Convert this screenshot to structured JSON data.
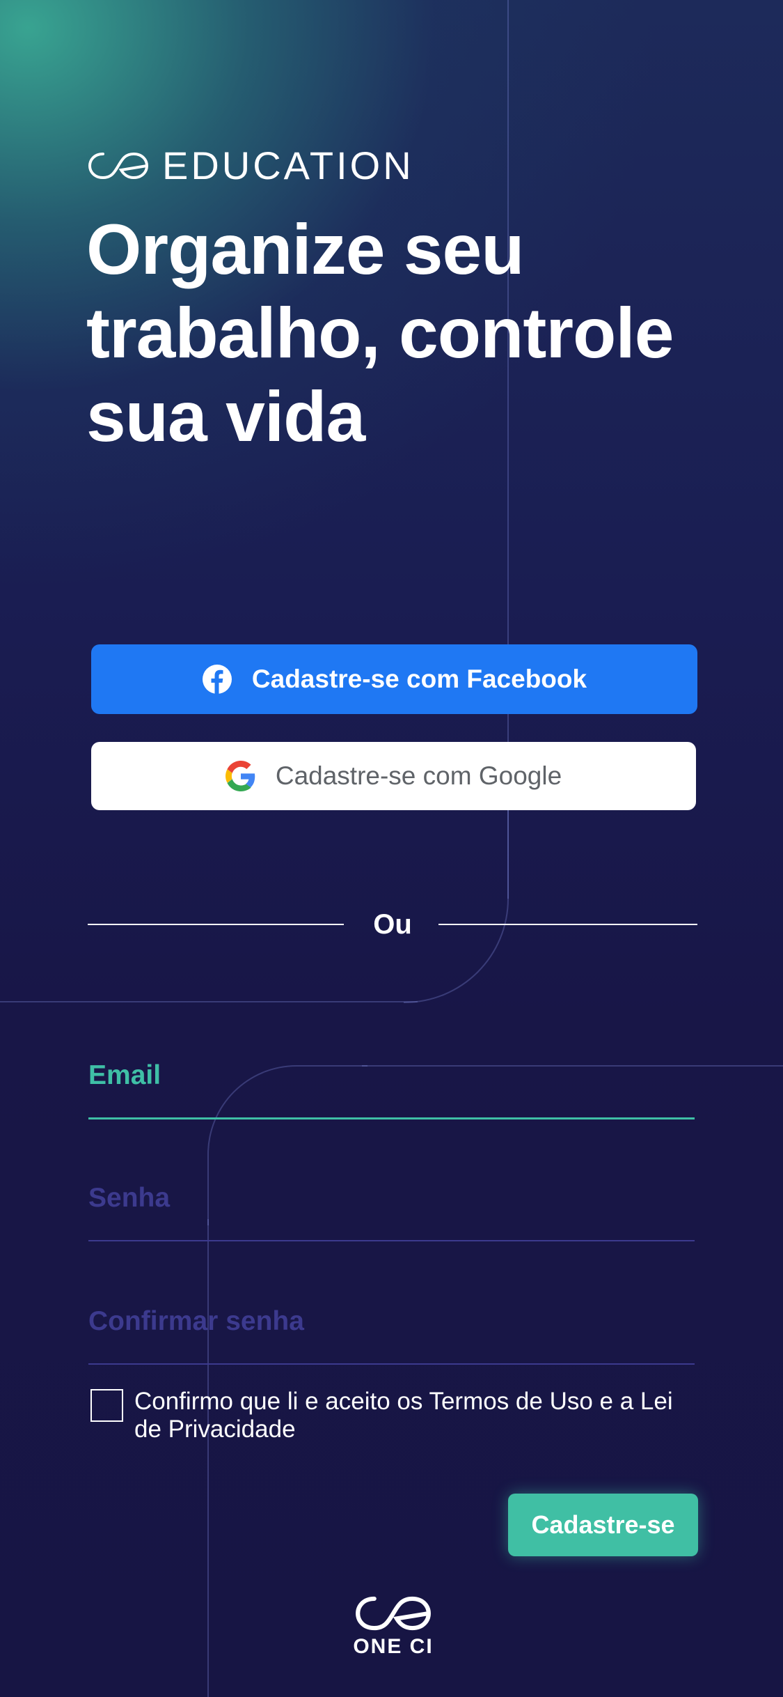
{
  "brand": {
    "icon": "oe-infinity-logo-icon",
    "name": "EDUCATION"
  },
  "headline": "Organize seu trabalho, controle sua vida",
  "social": {
    "facebook_label": "Cadastre-se com Facebook",
    "facebook_icon": "facebook-icon",
    "google_label": "Cadastre-se com Google",
    "google_icon": "google-icon"
  },
  "divider_label": "Ou",
  "form": {
    "email_label": "Email",
    "password_label": "Senha",
    "confirm_password_label": "Confirmar senha",
    "terms_text": "Confirmo que li e aceito os Termos de Uso e a Lei de Privacidade",
    "submit_label": "Cadastre-se"
  },
  "footer": {
    "icon": "oe-infinity-logo-icon",
    "name": "ONE CI"
  },
  "colors": {
    "accent": "#40bfa4",
    "facebook": "#1f78f3",
    "background": "#171544",
    "inactive_field": "#3c3a8e"
  }
}
